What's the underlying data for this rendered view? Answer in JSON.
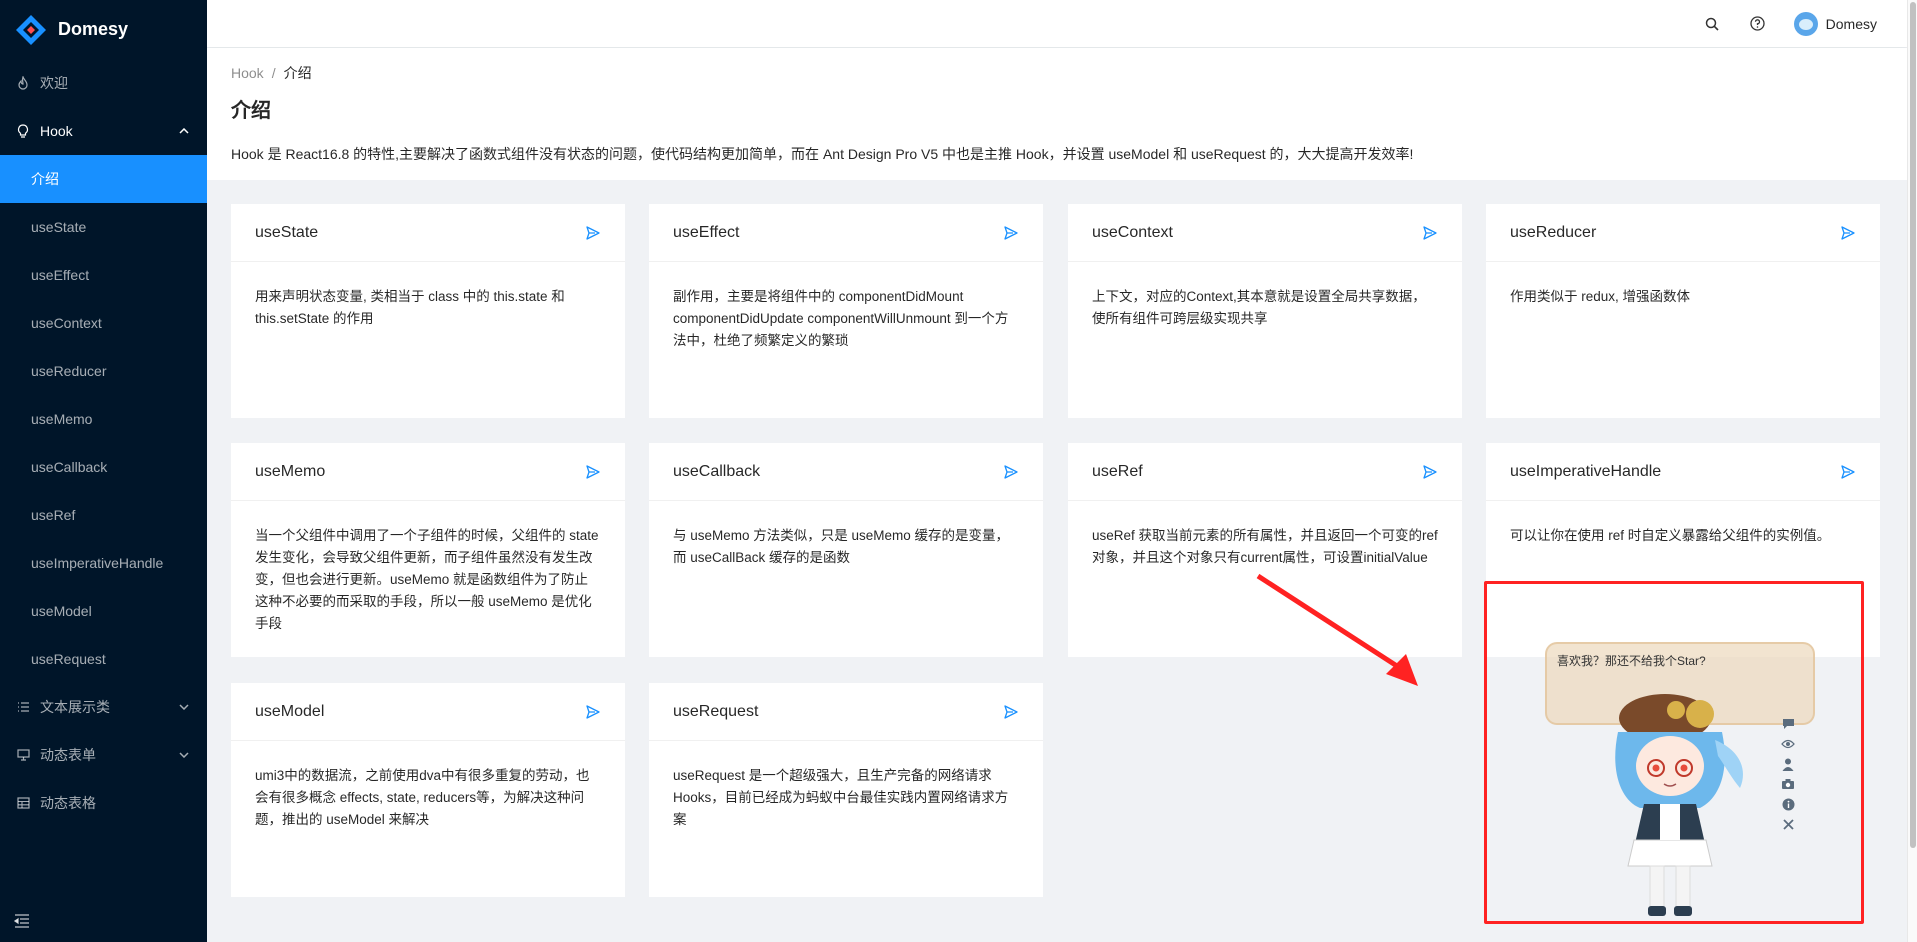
{
  "brand": {
    "name": "Domesy",
    "logo_color": "#1890ff"
  },
  "sidebar": {
    "items": [
      {
        "label": "欢迎",
        "icon": "fire-icon"
      },
      {
        "label": "Hook",
        "icon": "bulb-icon",
        "open": true,
        "children": [
          "介绍",
          "useState",
          "useEffect",
          "useContext",
          "useReducer",
          "useMemo",
          "useCallback",
          "useRef",
          "useImperativeHandle",
          "useModel",
          "useRequest"
        ],
        "active_child": "介绍"
      },
      {
        "label": "文本展示类",
        "icon": "list-icon"
      },
      {
        "label": "动态表单",
        "icon": "desktop-icon"
      },
      {
        "label": "动态表格",
        "icon": "table-icon"
      }
    ]
  },
  "header": {
    "user_name": "Domesy",
    "icons": [
      "search-icon",
      "question-circle-icon"
    ]
  },
  "breadcrumb": {
    "parent": "Hook",
    "separator": "/",
    "current": "介绍"
  },
  "page": {
    "title": "介绍",
    "description": "Hook 是 React16.8 的特性,主要解决了函数式组件没有状态的问题，使代码结构更加简单，而在 Ant Design Pro V5 中也是主推 Hook，并设置 useModel 和 useRequest 的，大大提高开发效率!"
  },
  "cards": [
    {
      "title": "useState",
      "body": "用来声明状态变量, 类相当于 class 中的 this.state 和 this.setState 的作用"
    },
    {
      "title": "useEffect",
      "body": "副作用，主要是将组件中的 componentDidMount componentDidUpdate componentWillUnmount 到一个方法中，杜绝了频繁定义的繁琐"
    },
    {
      "title": "useContext",
      "body": "上下文，对应的Context,其本意就是设置全局共享数据，使所有组件可跨层级实现共享"
    },
    {
      "title": "useReducer",
      "body": "作用类似于 redux, 增强函数体"
    },
    {
      "title": "useMemo",
      "body": "当一个父组件中调用了一个子组件的时候，父组件的 state 发生变化，会导致父组件更新，而子组件虽然没有发生改变，但也会进行更新。useMemo 就是函数组件为了防止这种不必要的而采取的手段，所以一般 useMemo 是优化手段"
    },
    {
      "title": "useCallback",
      "body": "与 useMemo 方法类似，只是 useMemo 缓存的是变量， 而 useCallBack 缓存的是函数"
    },
    {
      "title": "useRef",
      "body": "useRef 获取当前元素的所有属性，并且返回一个可变的ref对象，并且这个对象只有current属性，可设置initialValue"
    },
    {
      "title": "useImperativeHandle",
      "body": "可以让你在使用 ref 时自定义暴露给父组件的实例值。"
    },
    {
      "title": "useModel",
      "body": "umi3中的数据流，之前使用dva中有很多重复的劳动，也会有很多概念 effects, state, reducers等，为解决这种问题，推出的 useModel 来解决"
    },
    {
      "title": "useRequest",
      "body": "useRequest 是一个超级强大，且生产完备的网络请求 Hooks，目前已经成为蚂蚁中台最佳实践内置网络请求方案"
    }
  ],
  "mascot": {
    "bubble_text": "喜欢我？那还不给我个Star?",
    "tools": [
      "comment-icon",
      "eye-icon",
      "user-icon",
      "camera-icon",
      "info-icon",
      "close-icon"
    ]
  },
  "colors": {
    "accent": "#1890ff",
    "sidebar_bg": "#001529",
    "highlight": "#ff2222"
  }
}
